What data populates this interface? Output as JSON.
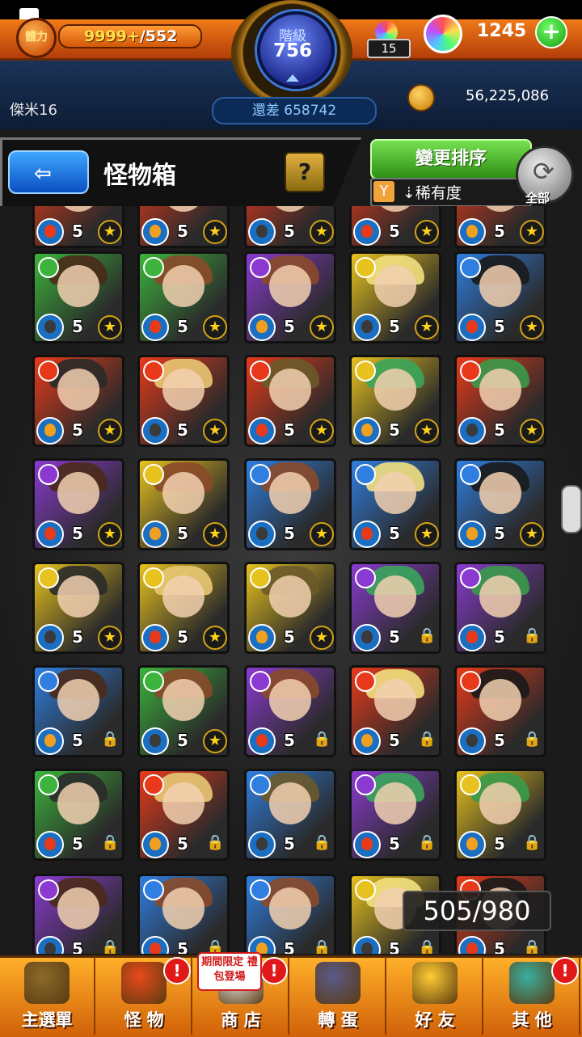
{
  "status": {
    "icon": "image-icon"
  },
  "header": {
    "stamina_label": "體力",
    "stamina_current": "9999+",
    "stamina_max": "/552",
    "rank_label": "階級",
    "rank_value": "756",
    "player_name": "傑米16",
    "exp_remaining": "還差 658742",
    "orb_small_count": "15",
    "orbs": "1245",
    "gold": "56,225,086",
    "plus_label": "+"
  },
  "panel": {
    "title": "怪物箱",
    "help_label": "?",
    "sort_button": "變更排序",
    "sort_mode": "稀有度",
    "refresh_label": "全部"
  },
  "box": {
    "count": "505/980",
    "level_text": "5"
  },
  "colors": {
    "fire": "#e83a1a",
    "water": "#2f7ee0",
    "wood": "#3cb33c",
    "light": "#e8c21e",
    "dark": "#8a3ad0"
  },
  "monsters": [
    {
      "element": "fire",
      "status": "star"
    },
    {
      "element": "fire",
      "status": "star"
    },
    {
      "element": "fire",
      "status": "star"
    },
    {
      "element": "fire",
      "status": "star"
    },
    {
      "element": "fire",
      "status": "star"
    },
    {
      "element": "wood",
      "status": "star"
    },
    {
      "element": "wood",
      "status": "star"
    },
    {
      "element": "dark",
      "status": "star"
    },
    {
      "element": "light",
      "status": "star"
    },
    {
      "element": "water",
      "status": "star"
    },
    {
      "element": "fire",
      "status": "star"
    },
    {
      "element": "fire",
      "status": "star"
    },
    {
      "element": "fire",
      "status": "star"
    },
    {
      "element": "light",
      "status": "star"
    },
    {
      "element": "fire",
      "status": "star"
    },
    {
      "element": "dark",
      "status": "star"
    },
    {
      "element": "light",
      "status": "star"
    },
    {
      "element": "water",
      "status": "star"
    },
    {
      "element": "water",
      "status": "star"
    },
    {
      "element": "water",
      "status": "star"
    },
    {
      "element": "light",
      "status": "star"
    },
    {
      "element": "light",
      "status": "star"
    },
    {
      "element": "light",
      "status": "star"
    },
    {
      "element": "dark",
      "status": "lock"
    },
    {
      "element": "dark",
      "status": "lock"
    },
    {
      "element": "water",
      "status": "lock"
    },
    {
      "element": "wood",
      "status": "star"
    },
    {
      "element": "dark",
      "status": "lock"
    },
    {
      "element": "fire",
      "status": "lock"
    },
    {
      "element": "fire",
      "status": "lock"
    },
    {
      "element": "wood",
      "status": "lock"
    },
    {
      "element": "fire",
      "status": "lock"
    },
    {
      "element": "water",
      "status": "lock"
    },
    {
      "element": "dark",
      "status": "lock"
    },
    {
      "element": "light",
      "status": "lock"
    },
    {
      "element": "dark",
      "status": "lock"
    },
    {
      "element": "water",
      "status": "lock"
    },
    {
      "element": "water",
      "status": "lock"
    },
    {
      "element": "light",
      "status": "lock"
    },
    {
      "element": "fire",
      "status": "lock"
    }
  ],
  "nav": [
    {
      "label": "主選單",
      "icon": "castle-icon",
      "badge": ""
    },
    {
      "label": "怪 物",
      "icon": "monster-icon",
      "badge": "!"
    },
    {
      "label": "商 店",
      "icon": "shop-orb-icon",
      "badge": "!",
      "promo": "期間限定\n禮包登場"
    },
    {
      "label": "轉 蛋",
      "icon": "gacha-icon",
      "badge": ""
    },
    {
      "label": "好 友",
      "icon": "friends-icon",
      "badge": ""
    },
    {
      "label": "其 他",
      "icon": "other-icon",
      "badge": "!"
    }
  ]
}
